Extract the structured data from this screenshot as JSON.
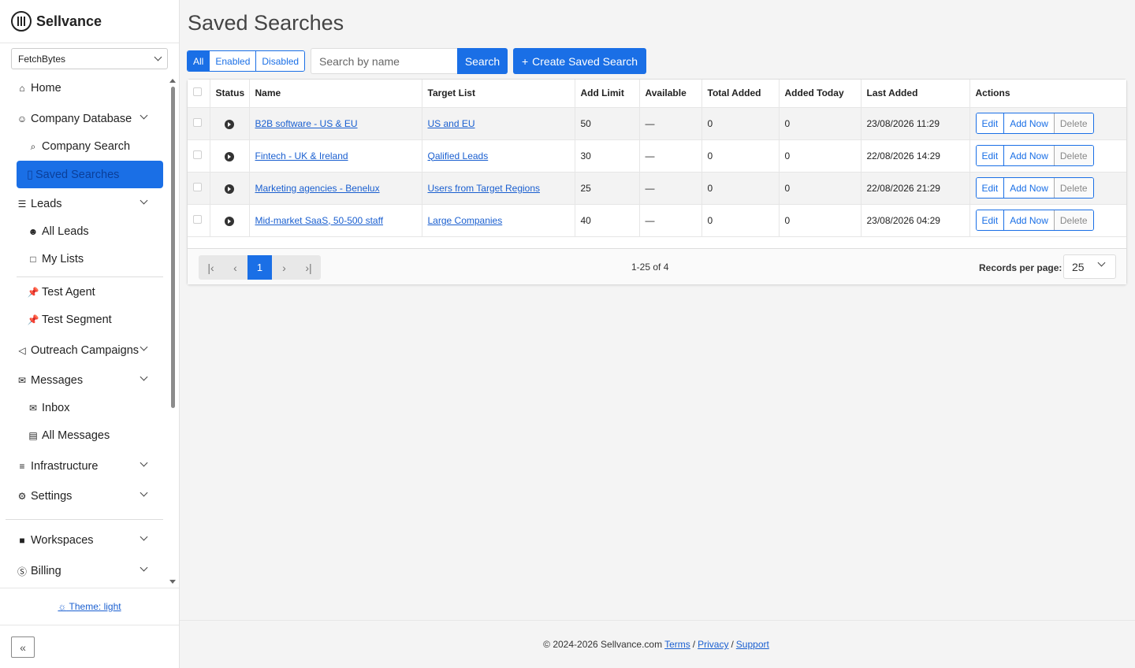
{
  "brand": {
    "name": "Sellvance"
  },
  "workspace": {
    "selected": "FetchBytes"
  },
  "nav": {
    "home": "Home",
    "company_database": "Company Database",
    "company_search": "Company Search",
    "saved_searches": "Saved Searches",
    "leads": "Leads",
    "all_leads": "All Leads",
    "my_lists": "My Lists",
    "test_agent": "Test Agent",
    "test_segment": "Test Segment",
    "outreach_campaigns": "Outreach Campaigns",
    "messages": "Messages",
    "inbox": "Inbox",
    "all_messages": "All Messages",
    "infrastructure": "Infrastructure",
    "settings": "Settings",
    "workspaces": "Workspaces",
    "billing": "Billing"
  },
  "theme": {
    "label": "Theme: light"
  },
  "page": {
    "title": "Saved Searches"
  },
  "filters": {
    "all": "All",
    "enabled": "Enabled",
    "disabled": "Disabled",
    "active": "All"
  },
  "search": {
    "placeholder": "Search by name",
    "button": "Search"
  },
  "create_button": "Create Saved Search",
  "table": {
    "headers": {
      "status": "Status",
      "name": "Name",
      "target_list": "Target List",
      "add_limit": "Add Limit",
      "available": "Available",
      "total_added": "Total Added",
      "added_today": "Added Today",
      "last_added": "Last Added",
      "actions": "Actions"
    },
    "rows": [
      {
        "name": "B2B software - US & EU",
        "target_list": "US and EU",
        "add_limit": "50",
        "available": "—",
        "total_added": "0",
        "added_today": "0",
        "last_added": "23/08/2026 11:29"
      },
      {
        "name": "Fintech - UK & Ireland",
        "target_list": "Qalified Leads",
        "add_limit": "30",
        "available": "—",
        "total_added": "0",
        "added_today": "0",
        "last_added": "22/08/2026 14:29"
      },
      {
        "name": "Marketing agencies - Benelux",
        "target_list": "Users from Target Regions",
        "add_limit": "25",
        "available": "—",
        "total_added": "0",
        "added_today": "0",
        "last_added": "22/08/2026 21:29"
      },
      {
        "name": "Mid-market SaaS, 50-500 staff",
        "target_list": "Large Companies",
        "add_limit": "40",
        "available": "—",
        "total_added": "0",
        "added_today": "0",
        "last_added": "23/08/2026 04:29"
      }
    ],
    "actions": {
      "edit": "Edit",
      "add_now": "Add Now",
      "delete": "Delete"
    }
  },
  "pagination": {
    "current_page": "1",
    "range": "1-25 of 4",
    "records_per_page_label": "Records per page:",
    "records_per_page": "25"
  },
  "footer": {
    "copyright": "© 2024-2026 Sellvance.com",
    "terms": "Terms",
    "privacy": "Privacy",
    "support": "Support",
    "separator": "/"
  },
  "colors": {
    "primary": "#1a6fe6",
    "link": "#1a5fd0",
    "background": "#f4f4f4"
  }
}
